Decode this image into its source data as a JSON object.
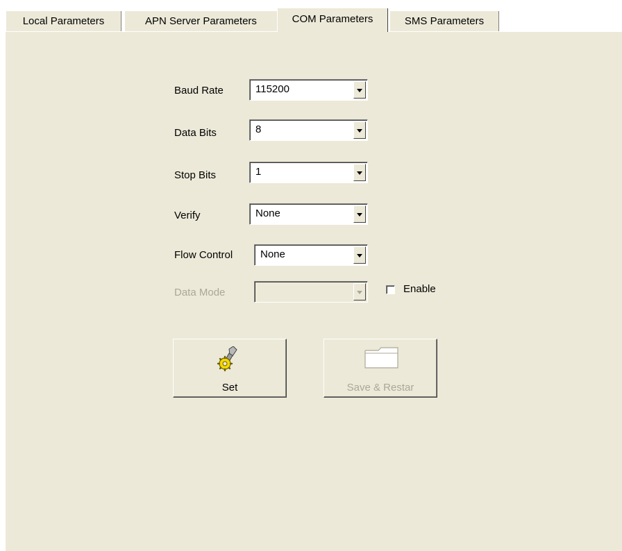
{
  "tabs": [
    {
      "label": "Local Parameters"
    },
    {
      "label": "APN Server Parameters"
    },
    {
      "label": "COM Parameters"
    },
    {
      "label": "SMS Parameters"
    }
  ],
  "form": {
    "baud_rate": {
      "label": "Baud Rate",
      "value": "115200"
    },
    "data_bits": {
      "label": "Data Bits",
      "value": "8"
    },
    "stop_bits": {
      "label": "Stop Bits",
      "value": "1"
    },
    "verify": {
      "label": "Verify",
      "value": "None"
    },
    "flow_control": {
      "label": "Flow Control",
      "value": "None"
    },
    "data_mode": {
      "label": "Data Mode",
      "value": "",
      "disabled": true
    },
    "enable_checkbox": {
      "label": "Enable",
      "checked": false
    }
  },
  "buttons": {
    "set": {
      "label": "Set",
      "icon": "gear-wrench-icon"
    },
    "save_restart": {
      "label": "Save & Restar",
      "icon": "folder-icon",
      "disabled": true
    }
  },
  "colors": {
    "panel": "#ece9d8",
    "disabled_text": "#aca899"
  }
}
